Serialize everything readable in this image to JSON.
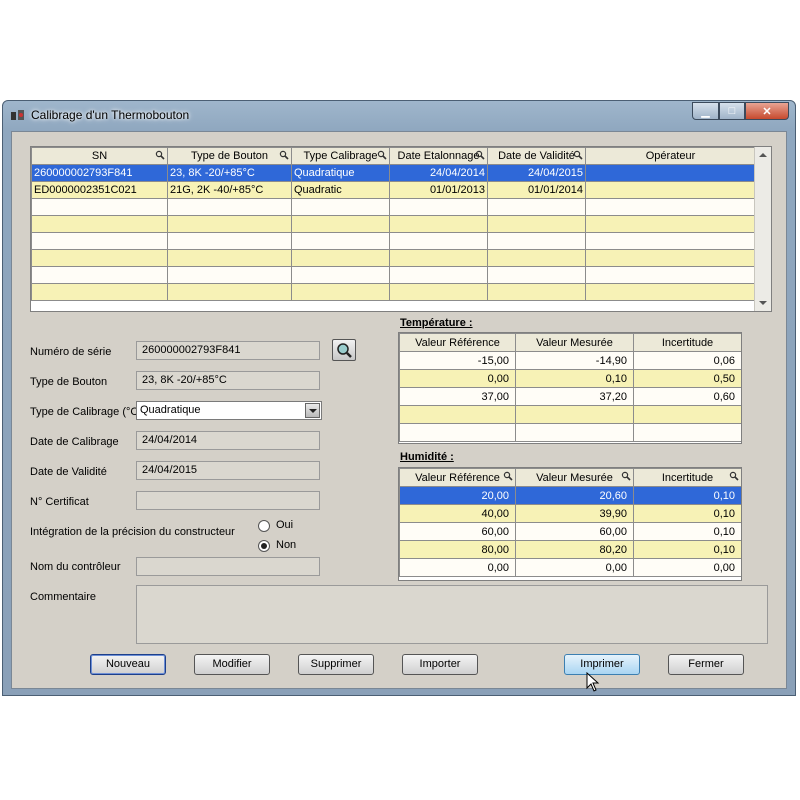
{
  "window": {
    "title": "Calibrage d'un Thermobouton",
    "minimize_glyph": "▁",
    "maximize_glyph": "□",
    "close_glyph": "✕"
  },
  "main_grid": {
    "columns": [
      "SN",
      "Type de Bouton",
      "Type Calibrage",
      "Date Etalonnage",
      "Date de Validité",
      "Opérateur"
    ],
    "rows": [
      [
        "260000002793F841",
        "23, 8K -20/+85°C",
        "Quadratique",
        "24/04/2014",
        "24/04/2015",
        ""
      ],
      [
        "ED0000002351C021",
        "21G, 2K -40/+85°C",
        "Quadratic",
        "01/01/2013",
        "01/01/2014",
        ""
      ]
    ],
    "selected_row": 0
  },
  "form": {
    "serial_label": "Numéro de série",
    "serial_value": "260000002793F841",
    "button_type_label": "Type de Bouton",
    "button_type_value": "23, 8K -20/+85°C",
    "calibration_type_label": "Type de Calibrage (°C)",
    "calibration_type_value": "Quadratique",
    "calibration_date_label": "Date de Calibrage",
    "calibration_date_value": "24/04/2014",
    "validity_date_label": "Date de Validité",
    "validity_date_value": "24/04/2015",
    "certificate_label": "N° Certificat",
    "certificate_value": "",
    "precision_label": "Intégration de la précision du constructeur",
    "option_yes": "Oui",
    "option_no": "Non",
    "selected_option": "Non",
    "controller_label": "Nom du contrôleur",
    "controller_value": "",
    "comment_label": "Commentaire",
    "comment_value": ""
  },
  "temperature": {
    "title": "Température :",
    "columns": [
      "Valeur Référence",
      "Valeur Mesurée",
      "Incertitude"
    ],
    "rows": [
      [
        "-15,00",
        "-14,90",
        "0,06"
      ],
      [
        "0,00",
        "0,10",
        "0,50"
      ],
      [
        "37,00",
        "37,20",
        "0,60"
      ]
    ]
  },
  "humidity": {
    "title": "Humidité :",
    "columns": [
      "Valeur Référence",
      "Valeur Mesurée",
      "Incertitude"
    ],
    "rows": [
      [
        "20,00",
        "20,60",
        "0,10"
      ],
      [
        "40,00",
        "39,90",
        "0,10"
      ],
      [
        "60,00",
        "60,00",
        "0,10"
      ],
      [
        "80,00",
        "80,20",
        "0,10"
      ],
      [
        "0,00",
        "0,00",
        "0,00"
      ]
    ],
    "selected_row": 0
  },
  "buttons": {
    "new": "Nouveau",
    "modify": "Modifier",
    "delete": "Supprimer",
    "import": "Importer",
    "print": "Imprimer",
    "close": "Fermer"
  },
  "icons": [
    "thermobutton-app-icon",
    "magnifier-icon",
    "dropdown-arrow-icon",
    "mouse-cursor-icon"
  ],
  "colors": {
    "selection": "#2f68d8",
    "row_alt": "#f7f2b6",
    "client_bg": "#d4d0c8"
  }
}
